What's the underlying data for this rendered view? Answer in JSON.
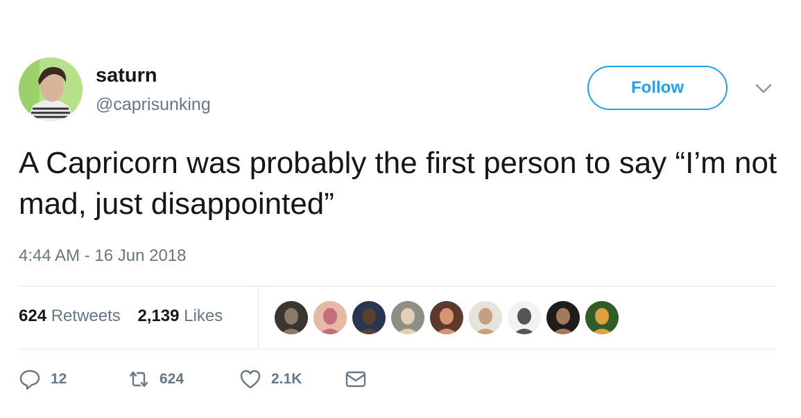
{
  "user": {
    "name": "saturn",
    "handle": "@caprisunking"
  },
  "follow_button": {
    "label": "Follow"
  },
  "tweet": {
    "text": "A Capricorn was probably the first person to say “I’m not mad, just disappointed”",
    "timestamp": "4:44 AM - 16 Jun 2018"
  },
  "stats": {
    "retweets_count": "624",
    "retweets_label": "Retweets",
    "likes_count": "2,139",
    "likes_label": "Likes"
  },
  "likers": [
    {
      "bg": "#3b3530",
      "fg": "#8a7a6c"
    },
    {
      "bg": "#e7b8a5",
      "fg": "#c0707a"
    },
    {
      "bg": "#2a3550",
      "fg": "#5a4030"
    },
    {
      "bg": "#8f8e85",
      "fg": "#e2d0b5"
    },
    {
      "bg": "#5c3a2e",
      "fg": "#d89470"
    },
    {
      "bg": "#e8e3da",
      "fg": "#c4a080"
    },
    {
      "bg": "#f2f2f2",
      "fg": "#555555"
    },
    {
      "bg": "#1f1d1c",
      "fg": "#a37a5c"
    },
    {
      "bg": "#2f5d2a",
      "fg": "#e0a040"
    }
  ],
  "actions": {
    "reply": {
      "icon": "reply-icon",
      "count": "12"
    },
    "retweet": {
      "icon": "retweet-icon",
      "count": "624"
    },
    "like": {
      "icon": "heart-icon",
      "count": "2.1K"
    },
    "message": {
      "icon": "envelope-icon"
    }
  },
  "colors": {
    "accent": "#1da1f2",
    "secondary_text": "#657786",
    "primary_text": "#14171a",
    "divider": "#e1e8ed"
  }
}
